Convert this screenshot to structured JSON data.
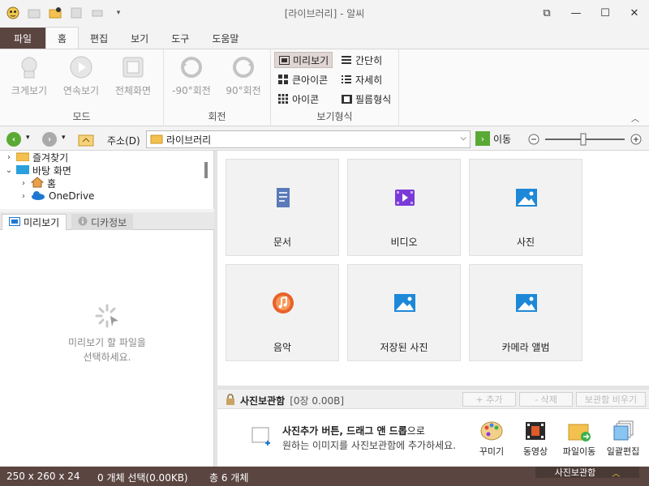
{
  "app": {
    "title": "[라이브러리] - 알씨"
  },
  "window_controls": [
    "restore-icon",
    "minimize-icon",
    "maximize-icon",
    "close-icon"
  ],
  "ribbon_tabs": [
    {
      "label": "파일"
    },
    {
      "label": "홈"
    },
    {
      "label": "편집"
    },
    {
      "label": "보기"
    },
    {
      "label": "도구"
    },
    {
      "label": "도움말"
    }
  ],
  "ribbon": {
    "mode": {
      "label": "모드",
      "buttons": [
        "크게보기",
        "연속보기",
        "전체화면"
      ]
    },
    "rotate": {
      "label": "회전",
      "buttons": [
        "-90°회전",
        "90°회전"
      ]
    },
    "view": {
      "label": "보기형식",
      "options": [
        "미리보기",
        "간단히",
        "큰아이콘",
        "자세히",
        "아이콘",
        "필름형식"
      ],
      "selected": "미리보기"
    }
  },
  "address": {
    "label": "주소(D)",
    "value": "라이브러리",
    "go_label": "이동"
  },
  "tree": {
    "items": [
      "즐겨찾기",
      "바탕 화면",
      "홈",
      "OneDrive"
    ]
  },
  "panel_tabs": [
    "미리보기",
    "디카정보"
  ],
  "preview": {
    "message_line1": "미리보기 할 파일을",
    "message_line2": "선택하세요."
  },
  "tiles": [
    "문서",
    "비디오",
    "사진",
    "음악",
    "저장된 사진",
    "카메라 앨범"
  ],
  "photo_storage": {
    "title": "사진보관함",
    "count": "[0장 0.00B]",
    "buttons": [
      "+ 추가",
      "- 삭제",
      "보관함 비우기"
    ],
    "hint_bold": "사진추가 버튼, 드래그 앤 드롭",
    "hint_suffix": "으로",
    "hint_line2": "원하는 이미지를 사진보관함에 추가하세요.",
    "tools": [
      "꾸미기",
      "동영상",
      "파일이동",
      "일괄편집"
    ]
  },
  "status": {
    "dimensions": "250 x 260 x 24",
    "selection": "0 개체 선택(0.00KB)",
    "total": "총 6 개체",
    "panel_button": "사진보관함"
  },
  "colors": {
    "brand": "#5a4540",
    "accent_blue": "#1e88d8",
    "go_green": "#5aa935"
  }
}
